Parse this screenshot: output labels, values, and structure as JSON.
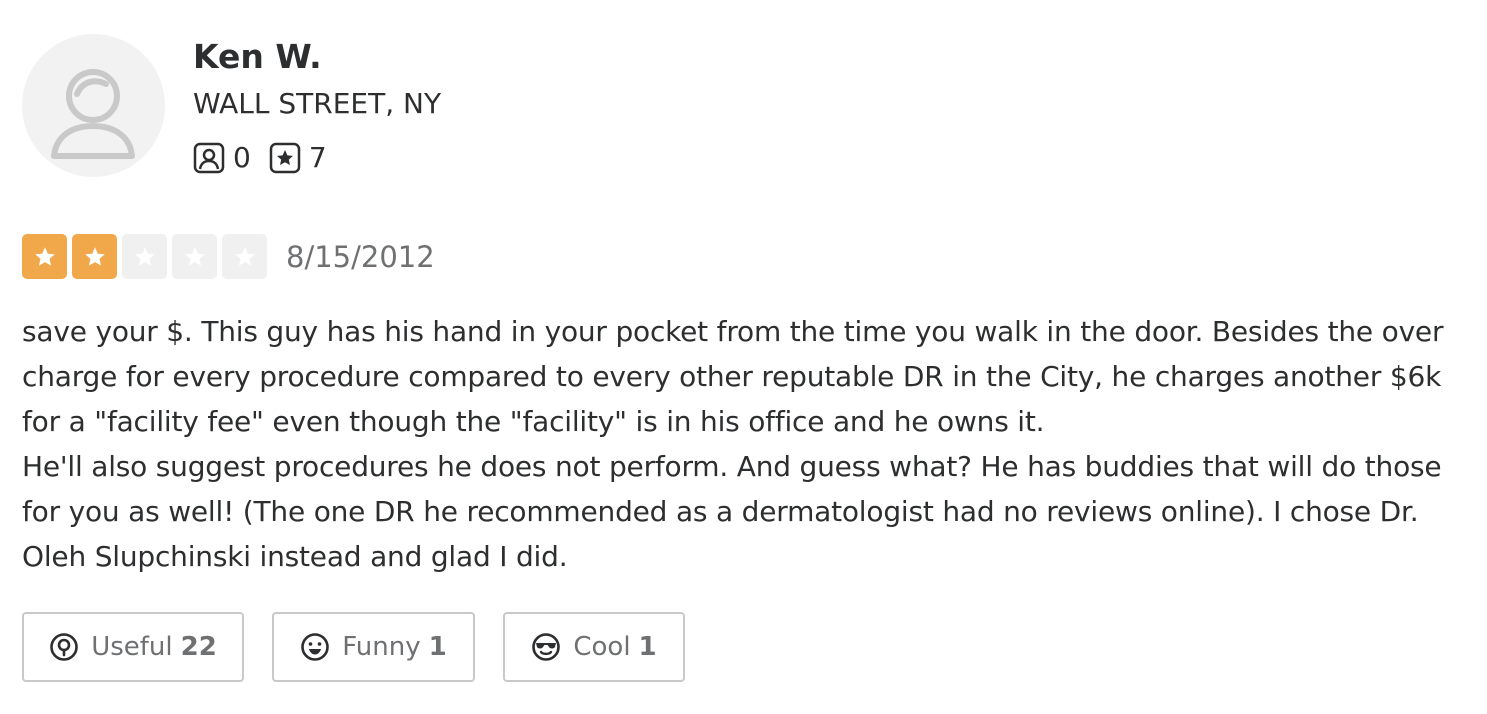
{
  "user": {
    "name": "Ken W.",
    "location": "WALL STREET, NY",
    "friends_count": "0",
    "reviews_count": "7",
    "avatar_icon": "default-user-avatar-icon"
  },
  "review": {
    "rating": 2,
    "rating_max": 5,
    "star_color_on": "#f0a84a",
    "star_color_off": "#f0f0f0",
    "date": "8/15/2012",
    "paragraphs": [
      "save your $. This guy has his hand in your pocket from the time you walk in the door. Besides the over charge for every procedure compared to every other reputable DR in the City, he charges another $6k for a \"facility fee\" even though the \"facility\" is in his office and he owns it.",
      "He'll also suggest procedures he does not perform. And guess what? He has buddies that will do those for you as well! (The one DR he recommended as a dermatologist had no reviews online). I chose Dr. Oleh Slupchinski instead and glad I did."
    ]
  },
  "reactions": {
    "useful": {
      "label": "Useful",
      "count": "22",
      "icon": "lightbulb-icon"
    },
    "funny": {
      "label": "Funny",
      "count": "1",
      "icon": "smile-icon"
    },
    "cool": {
      "label": "Cool",
      "count": "1",
      "icon": "sunglasses-face-icon"
    }
  }
}
